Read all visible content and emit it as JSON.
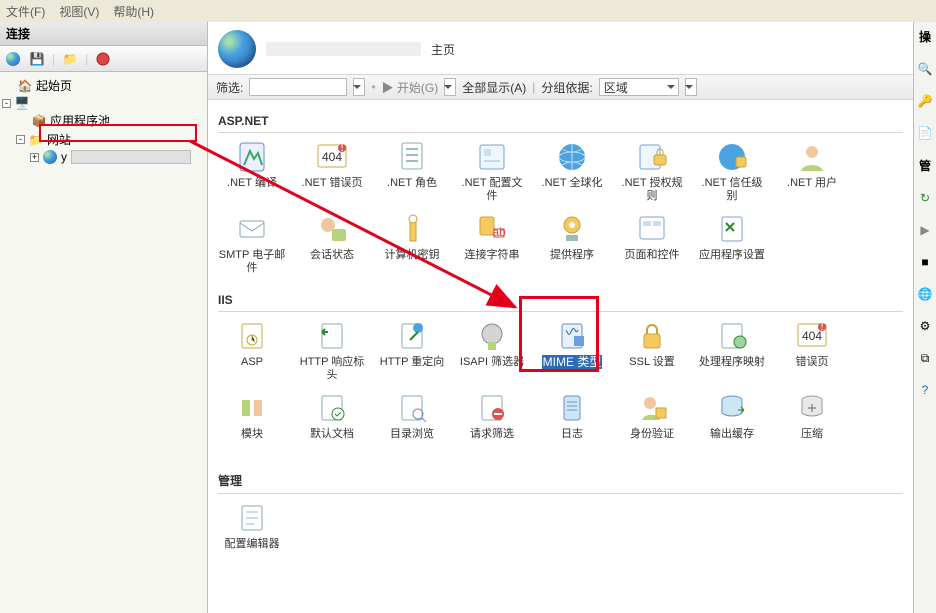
{
  "menubar": {
    "file": "文件(F)",
    "view": "视图(V)",
    "help": "帮助(H)"
  },
  "left": {
    "title": "连接",
    "tree": {
      "start": "起始页",
      "root": "",
      "pool": "应用程序池",
      "sites": "网站",
      "site1": "y"
    }
  },
  "header": {
    "suffix": "主页"
  },
  "filter": {
    "label": "筛选:",
    "start": "开始(G)",
    "showall": "全部显示(A)",
    "groupby": "分组依据:",
    "groupval": "区域"
  },
  "groups": {
    "aspnet": "ASP.NET",
    "iis": "IIS",
    "mgmt": "管理"
  },
  "aspnet": [
    ".NET 编译",
    ".NET 错误页",
    ".NET 角色",
    ".NET 配置文件",
    ".NET 全球化",
    ".NET 授权规则",
    ".NET 信任级别",
    ".NET 用户",
    "SMTP 电子邮件",
    "会话状态",
    "计算机密钥",
    "连接字符串",
    "提供程序",
    "页面和控件",
    "应用程序设置"
  ],
  "iis": [
    "ASP",
    "HTTP 响应标头",
    "HTTP 重定向",
    "ISAPI 筛选器",
    "MIME 类型",
    "SSL 设置",
    "处理程序映射",
    "错误页",
    "模块",
    "默认文档",
    "目录浏览",
    "请求筛选",
    "日志",
    "身份验证",
    "输出缓存",
    "压缩"
  ],
  "mgmt": [
    "配置编辑器"
  ],
  "right_title": "操作",
  "right_sub": "管理"
}
